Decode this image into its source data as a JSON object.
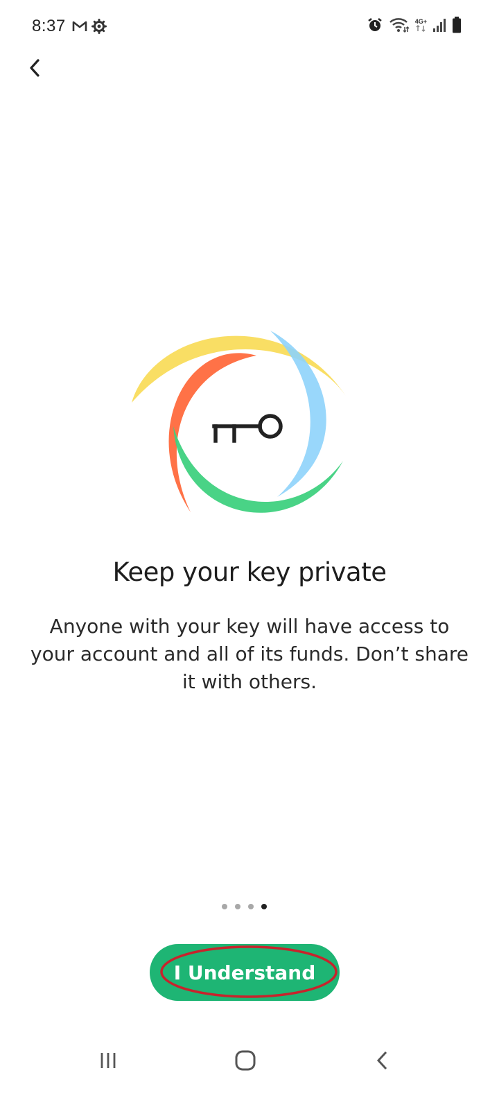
{
  "status_bar": {
    "time": "8:37",
    "network": "4G+",
    "left_icons": [
      "gmail-icon",
      "settings-icon"
    ],
    "right_icons": [
      "alarm-icon",
      "wifi-icon",
      "network-4g-icon",
      "signal-icon",
      "battery-icon"
    ]
  },
  "header": {
    "back_icon": "chevron-left-icon"
  },
  "illustration": {
    "icon": "key-icon",
    "colors": {
      "yellow": "#F9DC5C",
      "blue": "#8ED3FB",
      "orange": "#FF6A3D",
      "green": "#3FD17F",
      "key": "#222222"
    }
  },
  "content": {
    "title": "Keep your key private",
    "description": "Anyone with your key will have access to your account and all of its funds. Don’t share it with others."
  },
  "pager": {
    "total": 4,
    "active_index": 3
  },
  "cta": {
    "label": "I Understand",
    "color": "#1EB574",
    "highlight_color": "#C8232C"
  },
  "nav_bar": {
    "icons": [
      "recent-apps-icon",
      "home-icon",
      "back-icon"
    ]
  }
}
